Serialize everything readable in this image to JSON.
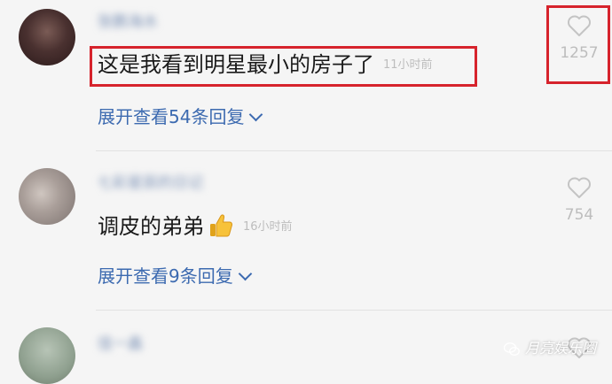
{
  "comments": [
    {
      "username": "张鹏海水",
      "text": "这是我看到明星最小的房子了",
      "time": "11小时前",
      "replies": "展开查看54条回复",
      "likes": "1257"
    },
    {
      "username": "七彩星辰的日记",
      "text": "调皮的弟弟",
      "emoji": "thumbs-up-emoji",
      "time": "16小时前",
      "replies": "展开查看9条回复",
      "likes": "754"
    },
    {
      "username": "佳一鑫"
    }
  ],
  "watermark": "月亮娱乐圈",
  "icons": {
    "like": "heart-outline-icon",
    "expand": "chevron-down-icon",
    "watermark": "wechat-icon"
  },
  "colors": {
    "highlight_box": "#d6232c",
    "reply_link": "#3c6ab0",
    "meta_text": "#bdbdbd"
  }
}
